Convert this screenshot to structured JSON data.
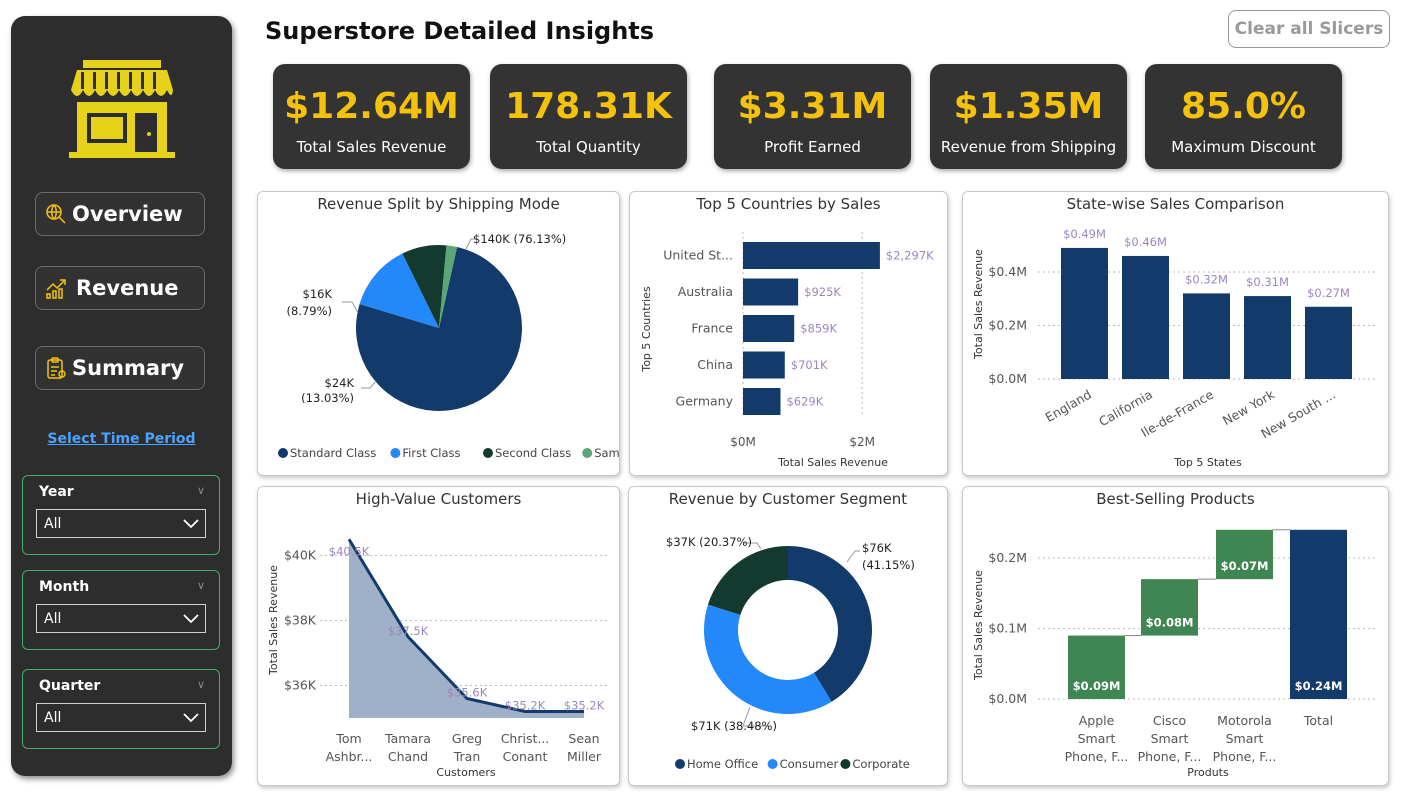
{
  "sidebar": {
    "nav": [
      {
        "label": "Overview"
      },
      {
        "label": "Revenue"
      },
      {
        "label": "Summary"
      }
    ],
    "select_time_label": "Select Time Period",
    "slicers": [
      {
        "label": "Year",
        "value": "All"
      },
      {
        "label": "Month",
        "value": "All"
      },
      {
        "label": "Quarter",
        "value": "All"
      }
    ]
  },
  "header": {
    "title": "Superstore Detailed Insights",
    "clear_label": "Clear all Slicers"
  },
  "kpis": [
    {
      "value": "$12.64M",
      "label": "Total Sales Revenue"
    },
    {
      "value": "178.31K",
      "label": "Total Quantity"
    },
    {
      "value": "$3.31M",
      "label": "Profit Earned"
    },
    {
      "value": "$1.35M",
      "label": "Revenue from Shipping"
    },
    {
      "value": "85.0%",
      "label": "Maximum Discount"
    }
  ],
  "colors": {
    "navy": "#123a6b",
    "blue": "#2388fa",
    "dark_green": "#14392f",
    "green": "#3f8652",
    "light_green": "#5aa676",
    "label_purple": "#9b86bd",
    "kpi_yellow": "#f4c20d"
  },
  "chart_data": [
    {
      "id": "shipping",
      "type": "pie",
      "title": "Revenue Split by Shipping Mode",
      "slices": [
        {
          "name": "Standard Class",
          "value": 140,
          "pct": 76.13,
          "label": "$140K (76.13%)"
        },
        {
          "name": "First Class",
          "value": 24,
          "pct": 13.03,
          "label_line1": "$24K",
          "label_line2": "(13.03%)"
        },
        {
          "name": "Second Class",
          "value": 16,
          "pct": 8.79,
          "label_line1": "$16K",
          "label_line2": "(8.79%)"
        },
        {
          "name": "Same Day",
          "value": 3.8,
          "pct": 2.05
        }
      ],
      "legend": "bottom"
    },
    {
      "id": "countries",
      "type": "bar",
      "orientation": "horizontal",
      "title": "Top 5 Countries by Sales",
      "categories": [
        "United St...",
        "Australia",
        "France",
        "China",
        "Germany"
      ],
      "values": [
        2297,
        925,
        859,
        701,
        629
      ],
      "value_labels": [
        "$2,297K",
        "$925K",
        "$859K",
        "$701K",
        "$629K"
      ],
      "xlabel": "Total Sales Revenue",
      "ylabel": "Top 5 Countries",
      "xlim": [
        0,
        2500
      ],
      "xticks": [
        {
          "v": 0,
          "label": "$0M"
        },
        {
          "v": 2000,
          "label": "$2M"
        }
      ]
    },
    {
      "id": "states",
      "type": "bar",
      "title": "State-wise Sales Comparison",
      "categories": [
        "England",
        "California",
        "Ile-de-France",
        "New York",
        "New South ..."
      ],
      "values": [
        0.49,
        0.46,
        0.32,
        0.31,
        0.27
      ],
      "value_labels": [
        "$0.49M",
        "$0.46M",
        "$0.32M",
        "$0.31M",
        "$0.27M"
      ],
      "xlabel": "Top 5 States",
      "ylabel": "Total Sales Revenue",
      "ylim": [
        0,
        0.5
      ],
      "yticks": [
        {
          "v": 0,
          "label": "$0.0M"
        },
        {
          "v": 0.2,
          "label": "$0.2M"
        },
        {
          "v": 0.4,
          "label": "$0.4M"
        }
      ]
    },
    {
      "id": "customers",
      "type": "area",
      "title": "High-Value Customers",
      "categories": [
        [
          "Tom",
          "Ashbr..."
        ],
        [
          "Tamara",
          "Chand"
        ],
        [
          "Greg",
          "Tran"
        ],
        [
          "Christ...",
          "Conant"
        ],
        [
          "Sean",
          "Miller"
        ]
      ],
      "values": [
        40.5,
        37.5,
        35.6,
        35.2,
        35.2
      ],
      "value_labels": [
        "$40.5K",
        "$37.5K",
        "$35.6K",
        "$35.2K",
        "$35.2K"
      ],
      "xlabel": "Customers",
      "ylabel": "Total Sales Revenue",
      "ylim": [
        35,
        41
      ],
      "yticks": [
        {
          "v": 36,
          "label": "$36K"
        },
        {
          "v": 38,
          "label": "$38K"
        },
        {
          "v": 40,
          "label": "$40K"
        }
      ]
    },
    {
      "id": "segments",
      "type": "pie",
      "variant": "donut",
      "title": "Revenue by Customer Segment",
      "slices": [
        {
          "name": "Home Office",
          "value": 76,
          "pct": 41.15,
          "label_line1": "$76K",
          "label_line2": "(41.15%)"
        },
        {
          "name": "Consumer",
          "value": 71,
          "pct": 38.48,
          "label": "$71K (38.48%)"
        },
        {
          "name": "Corporate",
          "value": 37,
          "pct": 20.37,
          "label": "$37K (20.37%)"
        }
      ],
      "legend": "bottom"
    },
    {
      "id": "products",
      "type": "bar",
      "variant": "waterfall",
      "title": "Best-Selling Products",
      "categories": [
        [
          "Apple",
          "Smart",
          "Phone, F..."
        ],
        [
          "Cisco",
          "Smart",
          "Phone, F..."
        ],
        [
          "Motorola",
          "Smart",
          "Phone, F..."
        ],
        [
          "Total"
        ]
      ],
      "values": [
        0.09,
        0.08,
        0.07,
        0.24
      ],
      "value_labels": [
        "$0.09M",
        "$0.08M",
        "$0.07M",
        "$0.24M"
      ],
      "xlabel": "Produts",
      "ylabel": "Total Sales Revenue",
      "ylim": [
        0,
        0.24
      ],
      "yticks": [
        {
          "v": 0,
          "label": "$0.0M"
        },
        {
          "v": 0.1,
          "label": "$0.1M"
        },
        {
          "v": 0.2,
          "label": "$0.2M"
        }
      ]
    }
  ]
}
